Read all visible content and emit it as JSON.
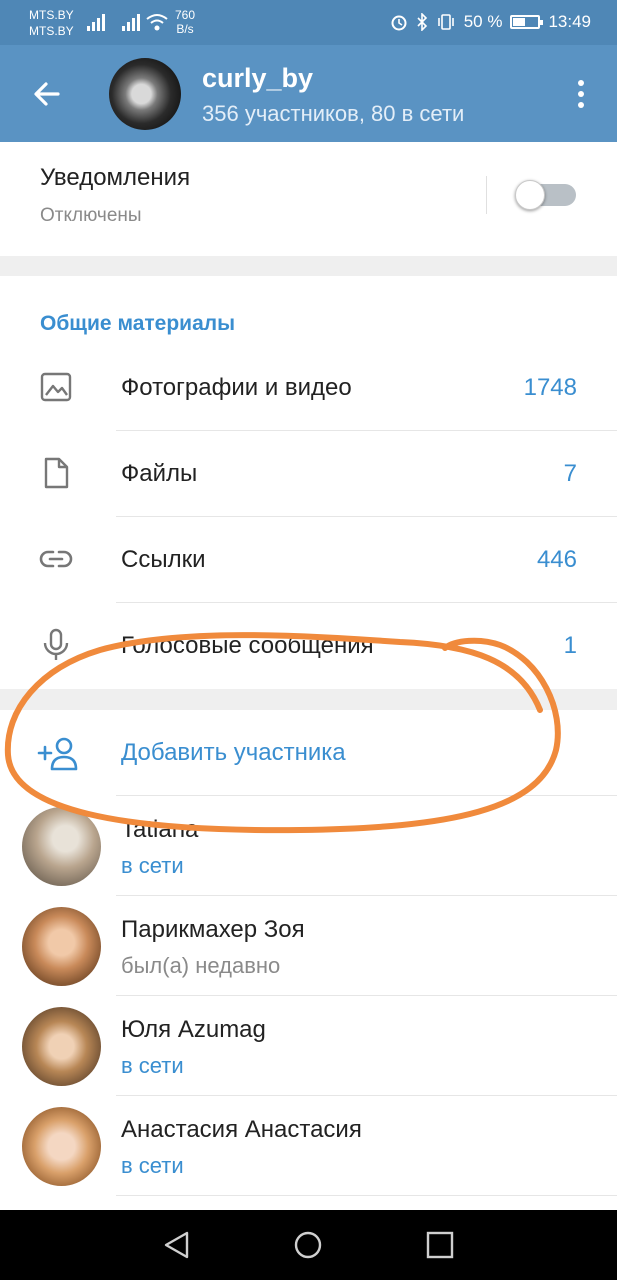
{
  "status_bar": {
    "carrier1": "MTS.BY",
    "carrier2": "MTS.BY",
    "speed_value": "760",
    "speed_unit": "B/s",
    "battery": "50 %",
    "time": "13:49"
  },
  "header": {
    "title": "curly_by",
    "subtitle": "356 участников, 80 в сети"
  },
  "notifications": {
    "title": "Уведомления",
    "status": "Отключены",
    "enabled": false
  },
  "shared_media": {
    "title": "Общие материалы",
    "items": [
      {
        "label": "Фотографии и видео",
        "count": "1748",
        "icon": "photo-icon"
      },
      {
        "label": "Файлы",
        "count": "7",
        "icon": "file-icon"
      },
      {
        "label": "Ссылки",
        "count": "446",
        "icon": "link-icon"
      },
      {
        "label": "Голосовые сообщения",
        "count": "1",
        "icon": "microphone-icon"
      }
    ]
  },
  "add_member": {
    "label": "Добавить участника",
    "icon": "add-user-icon"
  },
  "members": [
    {
      "name": "Tatiana",
      "status": "в сети",
      "online": true
    },
    {
      "name": "Парикмахер Зоя",
      "status": "был(а) недавно",
      "online": false
    },
    {
      "name": "Юля Azumag",
      "status": "в сети",
      "online": true
    },
    {
      "name": "Анастасия Анастасия",
      "status": "в сети",
      "online": true
    }
  ],
  "colors": {
    "header": "#5a93c3",
    "accent": "#3a8ed0",
    "annotation": "#f08a3c"
  }
}
